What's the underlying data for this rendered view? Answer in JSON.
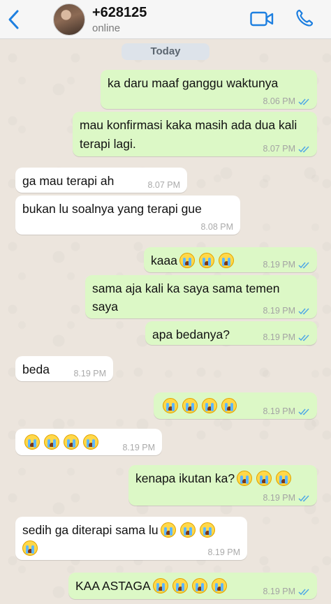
{
  "header": {
    "contact_name": "+628125",
    "status": "online",
    "back_icon": "chevron-left-icon",
    "video_icon": "video-camera-icon",
    "call_icon": "phone-icon",
    "accent_color": "#1d7fe0"
  },
  "chat": {
    "date_label": "Today",
    "messages": [
      {
        "dir": "out",
        "text": "ka daru maaf ganggu waktunya",
        "time": "8.06 PM",
        "read": true
      },
      {
        "dir": "out",
        "text": "mau konfirmasi kaka masih ada dua kali terapi lagi.",
        "time": "8.07 PM",
        "read": true
      },
      {
        "dir": "in",
        "text": "ga mau terapi ah",
        "time": "8.07 PM"
      },
      {
        "dir": "in",
        "text": "bukan lu soalnya yang terapi gue",
        "time": "8.08 PM"
      },
      {
        "dir": "out",
        "text": "kaaa",
        "emoji_count": 3,
        "time": "8.19 PM",
        "read": true
      },
      {
        "dir": "out",
        "text": "sama aja kali ka saya sama temen saya",
        "time": "8.19 PM",
        "read": true
      },
      {
        "dir": "out",
        "text": "apa bedanya?",
        "time": "8.19 PM",
        "read": true
      },
      {
        "dir": "in",
        "text": "beda",
        "time": "8.19 PM"
      },
      {
        "dir": "out",
        "text": "",
        "emoji_count": 4,
        "time": "8.19 PM",
        "read": true
      },
      {
        "dir": "in",
        "text": "",
        "emoji_count": 4,
        "time": "8.19 PM"
      },
      {
        "dir": "out",
        "text": "kenapa ikutan ka?",
        "emoji_count": 3,
        "time": "8.19 PM",
        "read": true
      },
      {
        "dir": "in",
        "text": "sedih ga diterapi sama lu",
        "emoji_count": 4,
        "time": "8.19 PM"
      },
      {
        "dir": "out",
        "text": "KAA ASTAGA",
        "emoji_count": 4,
        "time": "8.19 PM",
        "read": true
      }
    ],
    "emoji_icon": "loudly-crying-face-emoji",
    "read_receipt_icon": "double-check-icon",
    "outgoing_color": "#dcf8c6",
    "incoming_color": "#ffffff"
  }
}
